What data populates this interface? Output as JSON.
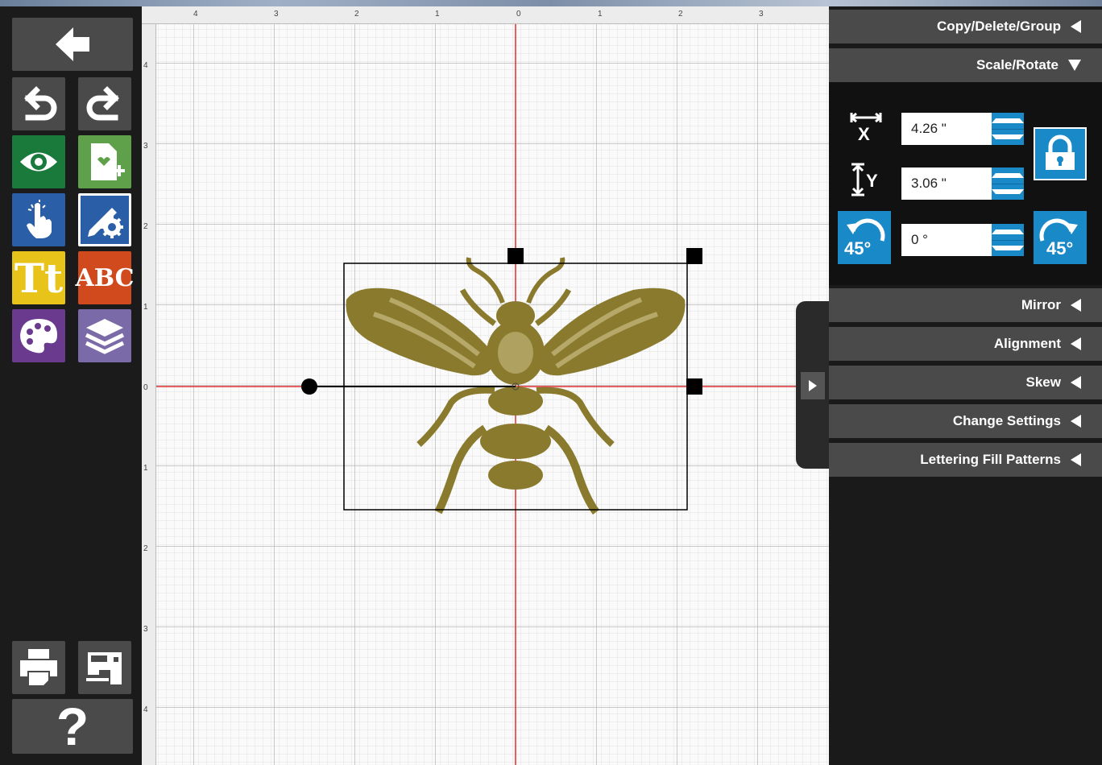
{
  "ruler": {
    "top_labels": [
      "4",
      "3",
      "2",
      "1",
      "0",
      "1",
      "2",
      "3"
    ],
    "left_labels": [
      "4",
      "3",
      "2",
      "1",
      "0",
      "1",
      "2",
      "3",
      "4"
    ]
  },
  "panel": {
    "sections": {
      "copy_delete_group": "Copy/Delete/Group",
      "scale_rotate": "Scale/Rotate",
      "mirror": "Mirror",
      "alignment": "Alignment",
      "skew": "Skew",
      "change_settings": "Change Settings",
      "lettering_fill_patterns": "Lettering Fill Patterns"
    },
    "scale": {
      "x_label": "X",
      "y_label": "Y",
      "x_value": "4.26 \"",
      "y_value": "3.06 \"",
      "rotation_value": "0 °",
      "rotate_left_label": "45°",
      "rotate_right_label": "45°"
    }
  },
  "toolbar": {
    "text_tool_label": "Tt",
    "monogram_label": "ABC",
    "help_label": "?"
  },
  "colors": {
    "accent_blue": "#1a89c8",
    "thread_gold": "#8a7a2e",
    "axis_red": "#e03030"
  }
}
